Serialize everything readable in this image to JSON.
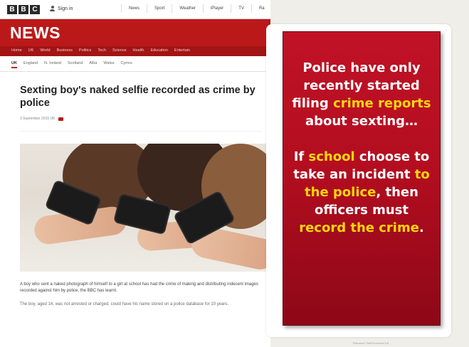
{
  "bbc": {
    "logo_letters": [
      "B",
      "B",
      "C"
    ],
    "signin": "Sign in",
    "top_nav": [
      "News",
      "Sport",
      "Weather",
      "iPlayer",
      "TV",
      "Ra"
    ],
    "news_wordmark": "NEWS",
    "news_nav": [
      "Home",
      "UK",
      "World",
      "Business",
      "Politics",
      "Tech",
      "Science",
      "Health",
      "Education",
      "Entertain"
    ],
    "sub_nav": [
      "UK",
      "England",
      "N. Ireland",
      "Scotland",
      "Alba",
      "Wales",
      "Cymru"
    ],
    "headline": "Sexting boy's naked selfie recorded as crime by police",
    "meta": "3 September 2015   UK",
    "body_p1": "A boy who sent a naked photograph of himself to a girl at school has had the crime of making and distributing indecent images recorded against him by police, the BBC has learnt.",
    "body_p2": "The boy, aged 14, was not arrested or charged, could have his name stored on a police database for 10 years."
  },
  "callout": {
    "p1_before": "Police have only recently started filing ",
    "p1_highlight": "crime reports",
    "p1_after": " about sexting…",
    "p2_part1": "If ",
    "p2_highlight1": "school",
    "p2_part2": " choose to take an incident ",
    "p2_highlight2": "to the police",
    "p2_part3": ", then officers must ",
    "p2_highlight3": "record the crime",
    "p2_part4": "."
  },
  "footer": "Education Child Protection Ltd",
  "colors": {
    "bbc_red": "#bb1919",
    "callout_red": "#b40e20",
    "highlight_yellow": "#ffd60a",
    "background": "#efeee8"
  }
}
